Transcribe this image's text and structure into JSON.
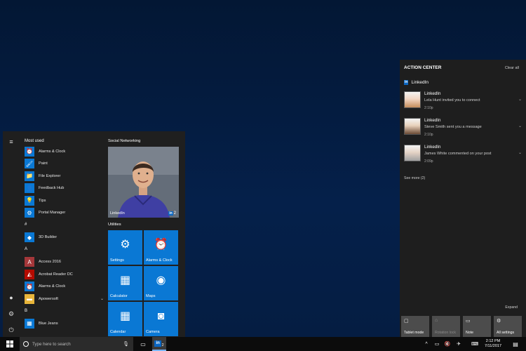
{
  "start_menu": {
    "most_used_header": "Most used",
    "apps": [
      {
        "label": "Alarms & Clock",
        "icon": "alarm-clock-icon",
        "glyph": "⏰",
        "color": "#0a78d4"
      },
      {
        "label": "Paint",
        "icon": "paint-icon",
        "glyph": "🖌",
        "color": "#0a78d4"
      },
      {
        "label": "File Explorer",
        "icon": "folder-icon",
        "glyph": "📁",
        "color": "#0a78d4"
      },
      {
        "label": "Feedback Hub",
        "icon": "feedback-icon",
        "glyph": "👤",
        "color": "#0a78d4"
      },
      {
        "label": "Tips",
        "icon": "lightbulb-icon",
        "glyph": "💡",
        "color": "#0a78d4"
      },
      {
        "label": "Portal Manager",
        "icon": "portal-icon",
        "glyph": "⚙",
        "color": "#0a78d4"
      },
      {
        "label": "#",
        "header": true
      },
      {
        "label": "3D Builder",
        "icon": "3d-builder-icon",
        "glyph": "◆",
        "color": "#0a78d4"
      },
      {
        "label": "A",
        "header": true
      },
      {
        "label": "Access 2016",
        "icon": "access-icon",
        "glyph": "A",
        "color": "#a4373a"
      },
      {
        "label": "Acrobat Reader DC",
        "icon": "acrobat-icon",
        "glyph": "◭",
        "color": "#b30b00"
      },
      {
        "label": "Alarms & Clock",
        "icon": "alarm-clock-icon",
        "glyph": "⏰",
        "color": "#0a78d4"
      },
      {
        "label": "Apowersoft",
        "icon": "folder-icon",
        "glyph": "▬",
        "color": "#e8b53a",
        "expandable": true
      },
      {
        "label": "B",
        "header": true
      },
      {
        "label": "Blue Jeans",
        "icon": "blue-jeans-icon",
        "glyph": "▦",
        "color": "#0a78d4"
      }
    ],
    "groups": {
      "social": "Social Networking",
      "utilities": "Utilities"
    },
    "photo_tile": {
      "label": "LinkedIn",
      "badge": "2"
    },
    "tiles": [
      {
        "label": "Settings",
        "icon": "gear-icon",
        "glyph": "⚙"
      },
      {
        "label": "Alarms & Clock",
        "icon": "alarm-clock-icon",
        "glyph": "⏰"
      },
      {
        "label": "Calculator",
        "icon": "calculator-icon",
        "glyph": "▦"
      },
      {
        "label": "Maps",
        "icon": "maps-icon",
        "glyph": "◉"
      },
      {
        "label": "Calendar",
        "icon": "calendar-icon",
        "glyph": "▦"
      },
      {
        "label": "Camera",
        "icon": "camera-icon",
        "glyph": "◙"
      }
    ]
  },
  "action_center": {
    "title": "ACTION CENTER",
    "clear_all": "Clear all",
    "app_name": "LinkedIn",
    "notifications": [
      {
        "title": "LinkedIn",
        "body": "Lela Hunt invited you to connect",
        "time": "2:10p"
      },
      {
        "title": "LinkedIn",
        "body": "Steve Smith sent you a message",
        "time": "2:10p"
      },
      {
        "title": "LinkedIn",
        "body": "James White commented on your post",
        "time": "2:09p"
      }
    ],
    "see_more": "See more (2)",
    "expand": "Expand",
    "quick_actions": [
      {
        "label": "Tablet mode",
        "icon": "tablet-mode-icon",
        "glyph": "▢",
        "dim": false
      },
      {
        "label": "Rotation lock",
        "icon": "rotation-lock-icon",
        "glyph": "⌂",
        "dim": true
      },
      {
        "label": "Note",
        "icon": "note-icon",
        "glyph": "▭",
        "dim": false
      },
      {
        "label": "All settings",
        "icon": "gear-icon",
        "glyph": "⚙",
        "dim": false
      }
    ]
  },
  "taskbar": {
    "search_placeholder": "Type here to search",
    "linkedin_badge": "2",
    "time": "2:12 PM",
    "date": "7/11/2017"
  },
  "colors": {
    "accent": "#0a78d4",
    "taskbar": "#0c0c0c",
    "action_center": "#1e1e1e"
  }
}
